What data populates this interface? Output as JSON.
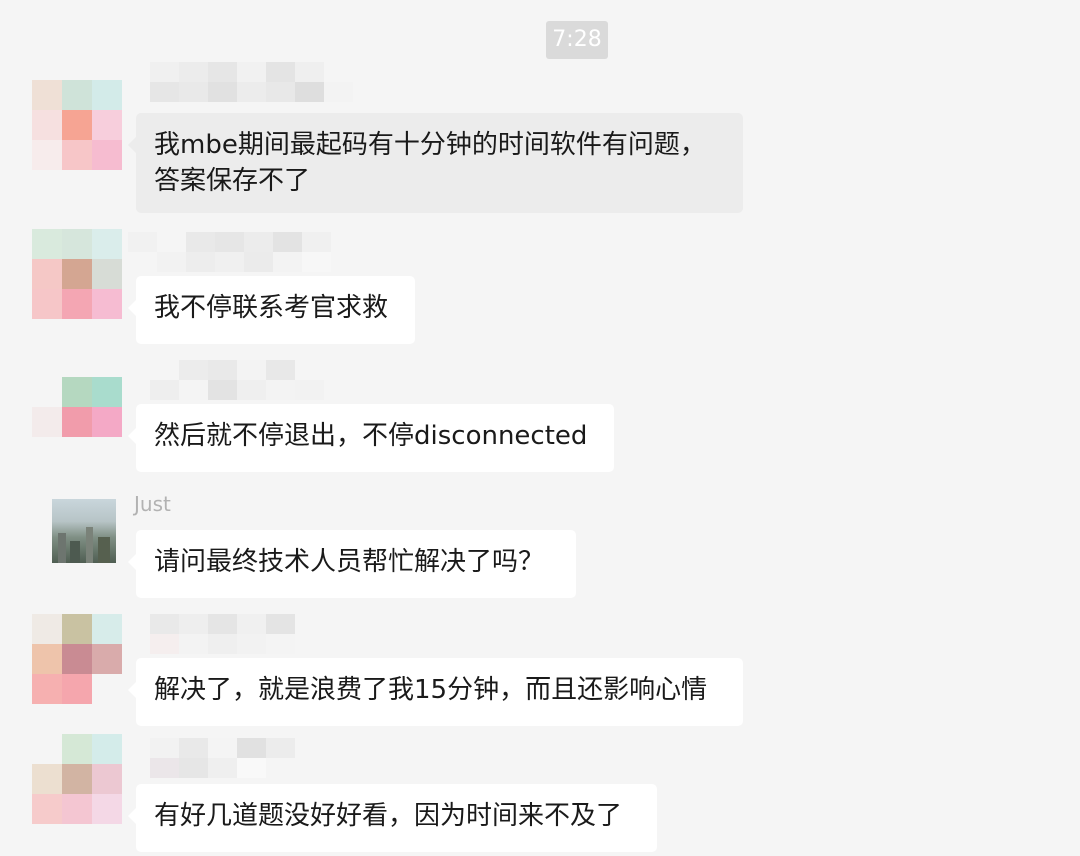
{
  "timestamp": "7:28",
  "messages": [
    {
      "sender": "",
      "text": "我mbe期间最起码有十分钟的时间软件有问题，\n答案保存不了"
    },
    {
      "sender": "",
      "text": "我不停联系考官求救"
    },
    {
      "sender": "",
      "text": "然后就不停退出，不停disconnected"
    },
    {
      "sender": "Just",
      "text": "请问最终技术人员帮忙解决了吗？"
    },
    {
      "sender": "",
      "text": "解决了，就是浪费了我15分钟，而且还影响心情"
    },
    {
      "sender": "",
      "text": "有好几道题没好好看，因为时间来不及了"
    }
  ]
}
